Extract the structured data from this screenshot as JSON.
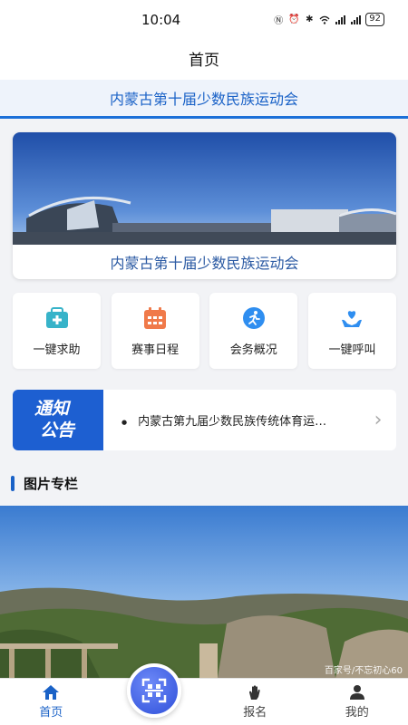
{
  "status_bar": {
    "time": "10:04",
    "battery": "92"
  },
  "nav": {
    "title": "首页"
  },
  "banner": {
    "title": "内蒙古第十届少数民族运动会"
  },
  "hero": {
    "caption": "内蒙古第十届少数民族运动会"
  },
  "quick_actions": [
    {
      "label": "一键求助",
      "icon": "medical-kit-icon"
    },
    {
      "label": "赛事日程",
      "icon": "calendar-icon"
    },
    {
      "label": "会务概况",
      "icon": "runner-icon"
    },
    {
      "label": "一键呼叫",
      "icon": "heart-hand-icon"
    }
  ],
  "notice": {
    "badge_line1": "通知",
    "badge_line2": "公告",
    "text": "内蒙古第九届少数民族传统体育运…"
  },
  "section": {
    "title": "图片专栏"
  },
  "photo": {
    "watermark": "百家号/不忘初心60"
  },
  "tab_bar": {
    "items": [
      {
        "label": "首页",
        "icon": "home-icon",
        "active": true
      },
      {
        "label": "",
        "icon": "scan-icon"
      },
      {
        "label": "报名",
        "icon": "hand-icon"
      },
      {
        "label": "我的",
        "icon": "user-icon"
      }
    ]
  },
  "colors": {
    "accent": "#1a62c7",
    "notice_blue": "#1d5fd1",
    "scan_purple": "#2e4fd9"
  }
}
